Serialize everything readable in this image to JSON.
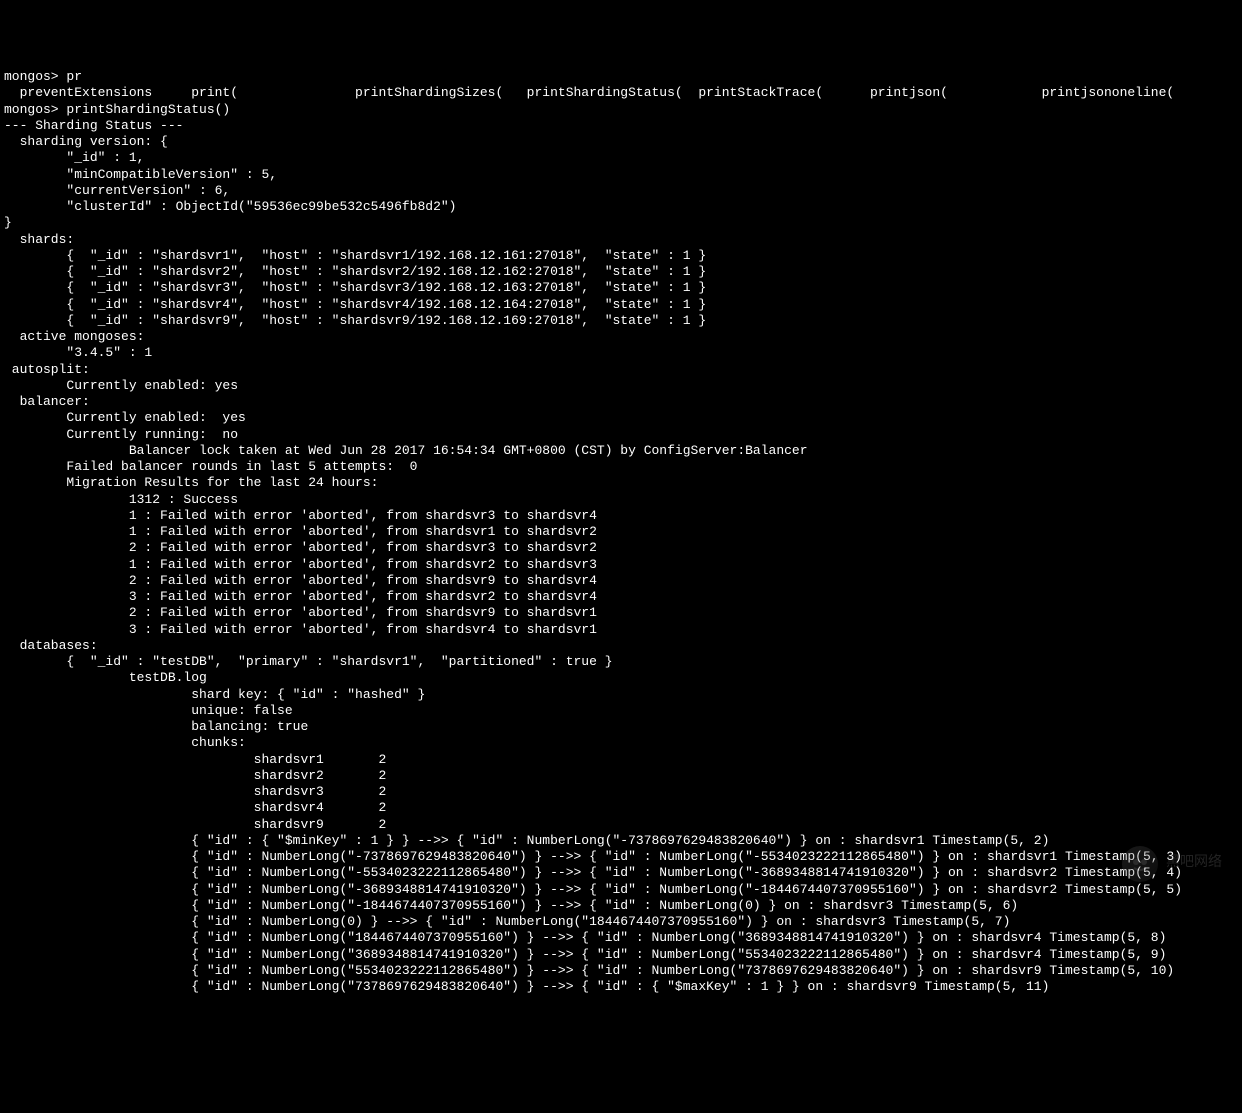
{
  "prompt1": "mongos> pr",
  "completions": "  preventExtensions     print(               printShardingSizes(   printShardingStatus(  printStackTrace(      printjson(            printjsononeline(",
  "prompt2": "mongos> printShardingStatus()",
  "header": "--- Sharding Status ---",
  "version_open": "  sharding version: {",
  "version_id": "        \"_id\" : 1,",
  "version_minCompat": "        \"minCompatibleVersion\" : 5,",
  "version_current": "        \"currentVersion\" : 6,",
  "version_clusterId": "        \"clusterId\" : ObjectId(\"59536ec99be532c5496fb8d2\")",
  "version_close": "}",
  "shards_header": "  shards:",
  "shard1": "        {  \"_id\" : \"shardsvr1\",  \"host\" : \"shardsvr1/192.168.12.161:27018\",  \"state\" : 1 }",
  "shard2": "        {  \"_id\" : \"shardsvr2\",  \"host\" : \"shardsvr2/192.168.12.162:27018\",  \"state\" : 1 }",
  "shard3": "        {  \"_id\" : \"shardsvr3\",  \"host\" : \"shardsvr3/192.168.12.163:27018\",  \"state\" : 1 }",
  "shard4": "        {  \"_id\" : \"shardsvr4\",  \"host\" : \"shardsvr4/192.168.12.164:27018\",  \"state\" : 1 }",
  "shard9": "        {  \"_id\" : \"shardsvr9\",  \"host\" : \"shardsvr9/192.168.12.169:27018\",  \"state\" : 1 }",
  "mongoses_header": "  active mongoses:",
  "mongoses_version": "        \"3.4.5\" : 1",
  "autosplit_header": " autosplit:",
  "autosplit_enabled": "        Currently enabled: yes",
  "balancer_header": "  balancer:",
  "balancer_enabled": "        Currently enabled:  yes",
  "balancer_running": "        Currently running:  no",
  "balancer_lock": "                Balancer lock taken at Wed Jun 28 2017 16:54:34 GMT+0800 (CST) by ConfigServer:Balancer",
  "balancer_failed": "        Failed balancer rounds in last 5 attempts:  0",
  "migration_header": "        Migration Results for the last 24 hours:",
  "migration_success": "                1312 : Success",
  "mig_err1": "                1 : Failed with error 'aborted', from shardsvr3 to shardsvr4",
  "mig_err2": "                1 : Failed with error 'aborted', from shardsvr1 to shardsvr2",
  "mig_err3": "                2 : Failed with error 'aborted', from shardsvr3 to shardsvr2",
  "mig_err4": "                1 : Failed with error 'aborted', from shardsvr2 to shardsvr3",
  "mig_err5": "                2 : Failed with error 'aborted', from shardsvr9 to shardsvr4",
  "mig_err6": "                3 : Failed with error 'aborted', from shardsvr2 to shardsvr4",
  "mig_err7": "                2 : Failed with error 'aborted', from shardsvr9 to shardsvr1",
  "mig_err8": "                3 : Failed with error 'aborted', from shardsvr4 to shardsvr1",
  "databases_header": "  databases:",
  "db_testdb": "        {  \"_id\" : \"testDB\",  \"primary\" : \"shardsvr1\",  \"partitioned\" : true }",
  "coll_name": "                testDB.log",
  "shard_key": "                        shard key: { \"id\" : \"hashed\" }",
  "unique": "                        unique: false",
  "balancing": "                        balancing: true",
  "chunks_header": "                        chunks:",
  "chunk_s1": "                                shardsvr1       2",
  "chunk_s2": "                                shardsvr2       2",
  "chunk_s3": "                                shardsvr3       2",
  "chunk_s4": "                                shardsvr4       2",
  "chunk_s9": "                                shardsvr9       2",
  "range1": "                        { \"id\" : { \"$minKey\" : 1 } } -->> { \"id\" : NumberLong(\"-7378697629483820640\") } on : shardsvr1 Timestamp(5, 2)",
  "range2": "                        { \"id\" : NumberLong(\"-7378697629483820640\") } -->> { \"id\" : NumberLong(\"-5534023222112865480\") } on : shardsvr1 Timestamp(5, 3)",
  "range3": "                        { \"id\" : NumberLong(\"-5534023222112865480\") } -->> { \"id\" : NumberLong(\"-3689348814741910320\") } on : shardsvr2 Timestamp(5, 4)",
  "range4": "                        { \"id\" : NumberLong(\"-3689348814741910320\") } -->> { \"id\" : NumberLong(\"-1844674407370955160\") } on : shardsvr2 Timestamp(5, 5)",
  "range5": "                        { \"id\" : NumberLong(\"-1844674407370955160\") } -->> { \"id\" : NumberLong(0) } on : shardsvr3 Timestamp(5, 6)",
  "range6": "                        { \"id\" : NumberLong(0) } -->> { \"id\" : NumberLong(\"1844674407370955160\") } on : shardsvr3 Timestamp(5, 7)",
  "range7": "                        { \"id\" : NumberLong(\"1844674407370955160\") } -->> { \"id\" : NumberLong(\"3689348814741910320\") } on : shardsvr4 Timestamp(5, 8)",
  "range8": "                        { \"id\" : NumberLong(\"3689348814741910320\") } -->> { \"id\" : NumberLong(\"5534023222112865480\") } on : shardsvr4 Timestamp(5, 9)",
  "range9": "                        { \"id\" : NumberLong(\"5534023222112865480\") } -->> { \"id\" : NumberLong(\"7378697629483820640\") } on : shardsvr9 Timestamp(5, 10)",
  "range10": "                        { \"id\" : NumberLong(\"7378697629483820640\") } -->> { \"id\" : { \"$maxKey\" : 1 } } on : shardsvr9 Timestamp(5, 11)",
  "watermark_text": "黑吧网络"
}
